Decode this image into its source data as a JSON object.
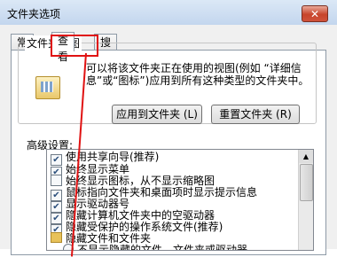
{
  "window": {
    "title": "文件夹选项",
    "close_label": "✕"
  },
  "tabs": [
    {
      "label": "常规"
    },
    {
      "label": "查看"
    },
    {
      "label": "搜索"
    }
  ],
  "folder_view": {
    "group_title": "文件夹视图",
    "description": "可以将该文件夹正在使用的视图(例如 “详细信息”或“图标”)应用到所有这种类型的文件夹中。",
    "apply_label": "应用到文件夹 (L)",
    "reset_label": "重置文件夹 (R)"
  },
  "advanced": {
    "label": "高级设置:",
    "items": [
      {
        "label": "使用共享向导(推荐)",
        "checked": "✔"
      },
      {
        "label": "始终显示菜单",
        "checked": "✔"
      },
      {
        "label": "始终显示图标，从不显示缩略图",
        "checked": ""
      },
      {
        "label": "鼠标指向文件夹和桌面项时显示提示信息",
        "checked": "✔"
      },
      {
        "label": "显示驱动器号",
        "checked": "✔"
      },
      {
        "label": "隐藏计算机文件夹中的空驱动器",
        "checked": "✔"
      },
      {
        "label": "隐藏受保护的操作系统文件(推荐)",
        "checked": "✔"
      },
      {
        "label": "隐藏文件和文件夹"
      },
      {
        "label": "不显示隐藏的文件、文件夹或驱动器"
      }
    ]
  },
  "icons": {
    "folder": "folder-view-icon",
    "scroll_up": "▲"
  }
}
